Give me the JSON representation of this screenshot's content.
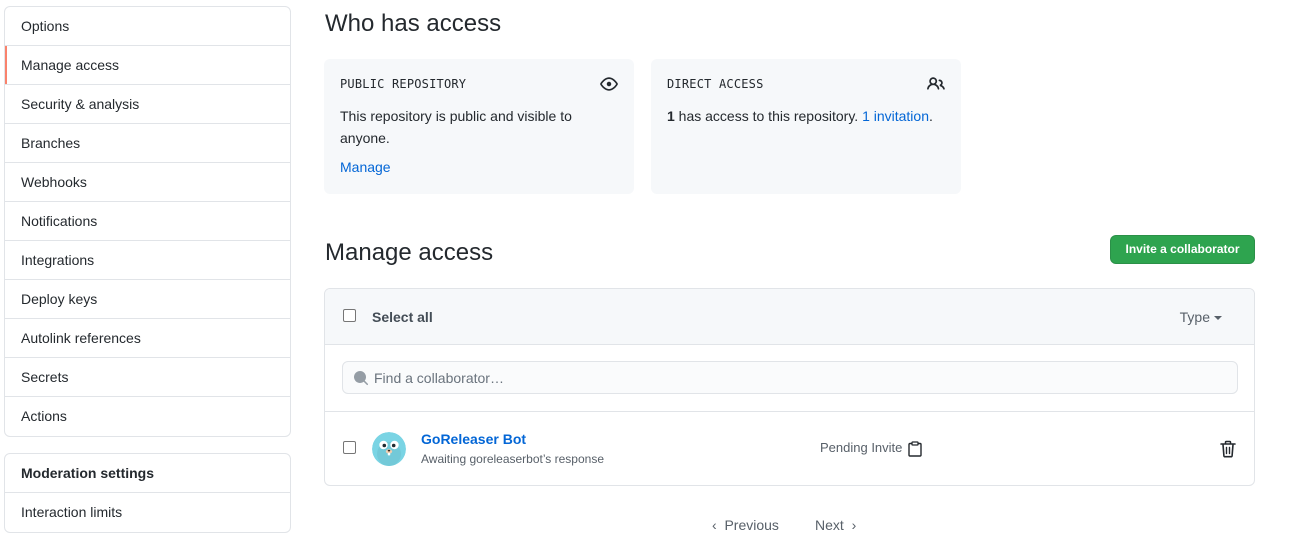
{
  "sidebar": {
    "items": [
      {
        "label": "Options"
      },
      {
        "label": "Manage access"
      },
      {
        "label": "Security & analysis"
      },
      {
        "label": "Branches"
      },
      {
        "label": "Webhooks"
      },
      {
        "label": "Notifications"
      },
      {
        "label": "Integrations"
      },
      {
        "label": "Deploy keys"
      },
      {
        "label": "Autolink references"
      },
      {
        "label": "Secrets"
      },
      {
        "label": "Actions"
      }
    ],
    "selected": "Manage access",
    "moderation": {
      "heading": "Moderation settings",
      "items": [
        {
          "label": "Interaction limits"
        }
      ]
    }
  },
  "who_has_access": {
    "title": "Who has access",
    "public_box": {
      "title": "PUBLIC REPOSITORY",
      "icon": "eye-icon",
      "text": "This repository is public and visible to anyone.",
      "link": "Manage"
    },
    "direct_box": {
      "title": "DIRECT ACCESS",
      "icon": "people-icon",
      "count": "1",
      "text": " has access to this repository. ",
      "link": "1 invitation",
      "suffix": "."
    }
  },
  "manage_access": {
    "title": "Manage access",
    "invite_button": "Invite a collaborator",
    "select_all": "Select all",
    "type_filter": "Type",
    "search_placeholder": "Find a collaborator…",
    "members": [
      {
        "name": "GoReleaser Bot",
        "subtitle": "Awaiting goreleaserbot’s response",
        "status": "Pending Invite"
      }
    ]
  },
  "pagination": {
    "previous": "Previous",
    "next": "Next"
  },
  "colors": {
    "accent": "#0366d6",
    "primary_button": "#2ea44f",
    "selected_marker": "#f9826c",
    "box_bg": "#f6f8fa"
  }
}
